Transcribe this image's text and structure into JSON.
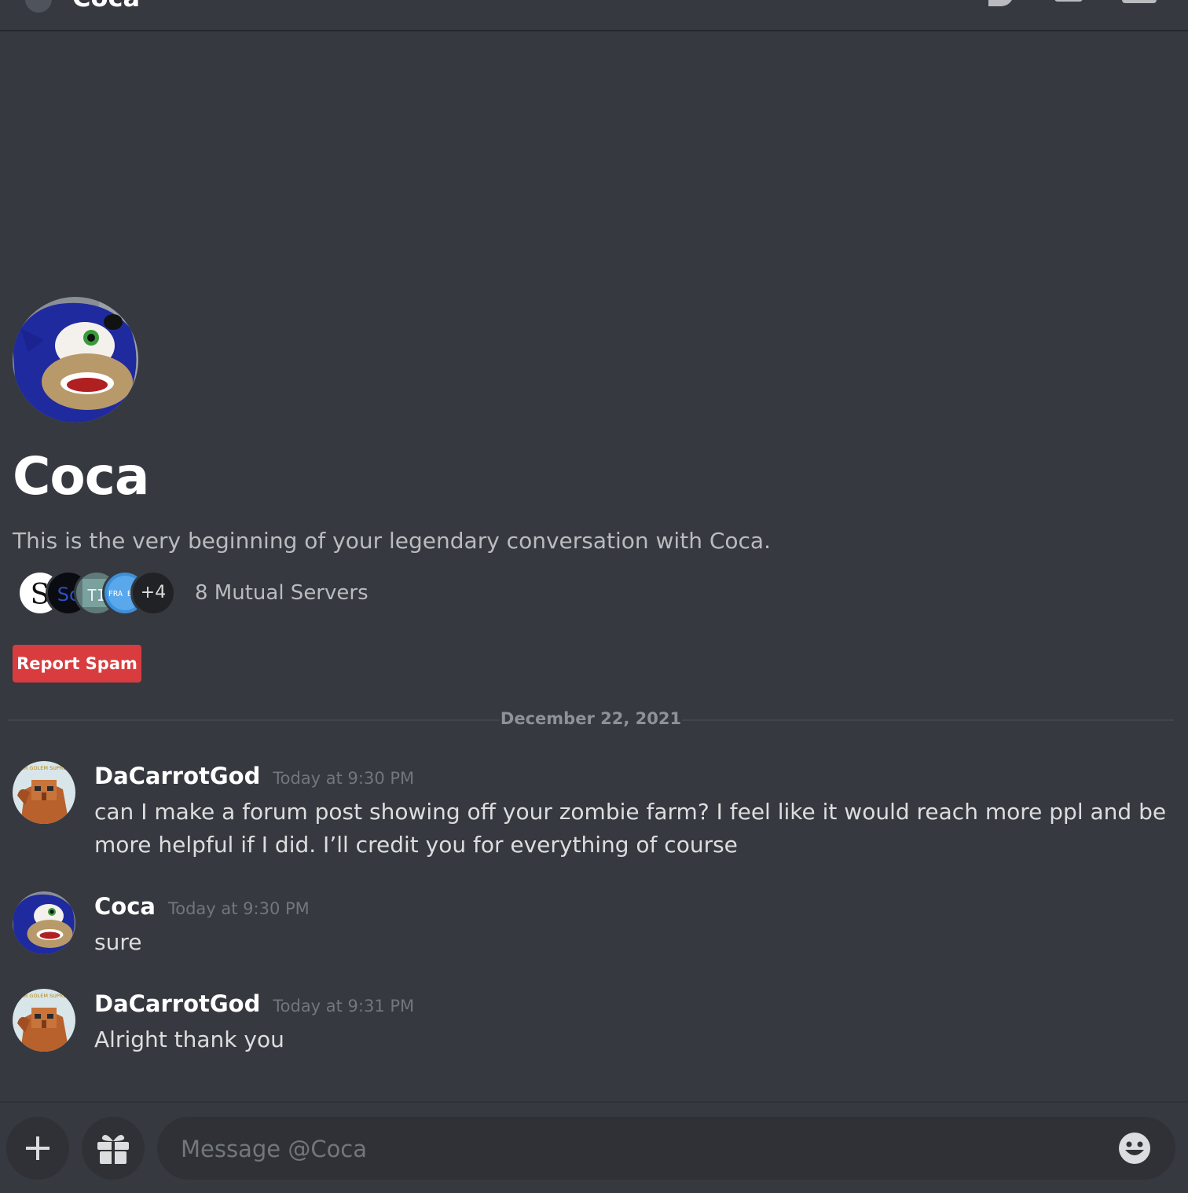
{
  "header": {
    "title": "Coca"
  },
  "intro": {
    "name": "Coca",
    "description": "This is the very beginning of your legendary conversation with Coca.",
    "mutual_more": "+4",
    "mutual_label": "8 Mutual Servers",
    "report_button": "Report Spam"
  },
  "mutual_servers": [
    {
      "icon": "S"
    },
    {
      "icon": "Sc"
    },
    {
      "icon": "TI"
    },
    {
      "icon": "FRA BOT"
    }
  ],
  "date_divider": "December 22, 2021",
  "messages": [
    {
      "author": "DaCarrotGod",
      "time": "Today at 9:30 PM",
      "text": "can I make a forum post showing off your zombie farm? I feel like it would reach more ppl and be more helpful if I did. I’ll credit you for everything of course"
    },
    {
      "author": "Coca",
      "time": "Today at 9:30 PM",
      "text": "sure"
    },
    {
      "author": "DaCarrotGod",
      "time": "Today at 9:31 PM",
      "text": "Alright thank you"
    }
  ],
  "avatar_text": {
    "copper_golem": "COPPER GOLEM SUPREMACY"
  },
  "composer": {
    "placeholder": "Message @Coca"
  },
  "colors": {
    "background": "#36393f",
    "input_background": "#2f3136",
    "report_red": "#d83c3e",
    "muted_text": "#b9bbbe",
    "timestamp": "#72767d"
  }
}
